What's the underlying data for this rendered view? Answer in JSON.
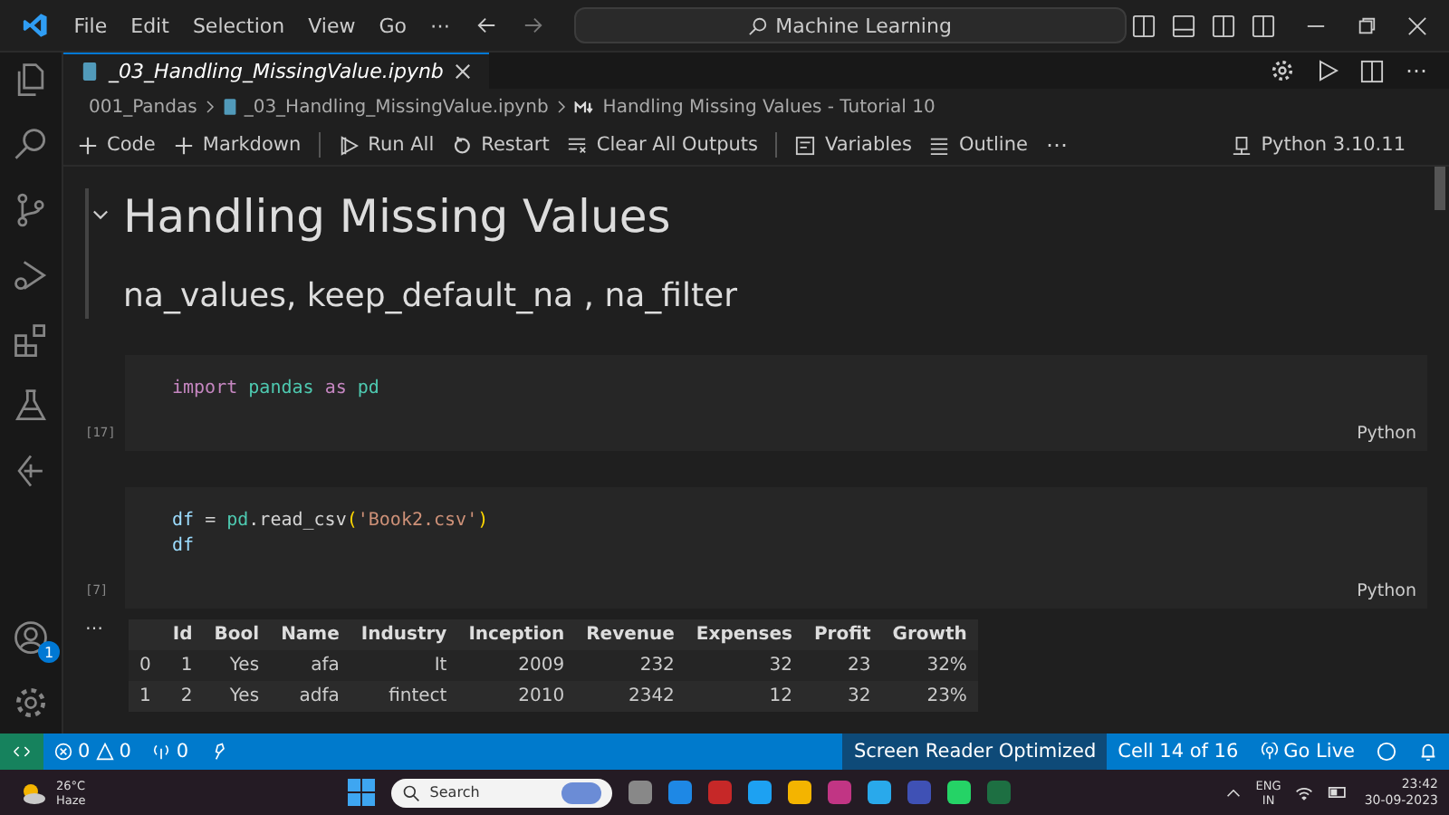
{
  "title_bar": {
    "menus": [
      "File",
      "Edit",
      "Selection",
      "View",
      "Go"
    ],
    "more": "⋯",
    "search": "Machine Learning"
  },
  "activity_bar": {
    "account_badge": "1"
  },
  "editor_tab": {
    "title": "_03_Handling_MissingValue.ipynb",
    "selected": true
  },
  "breadcrumb": [
    "001_Pandas",
    "_03_Handling_MissingValue.ipynb",
    "Handling Missing Values - Tutorial 10"
  ],
  "toolbar": {
    "items": [
      {
        "kind": "add",
        "label": "Code"
      },
      {
        "kind": "add",
        "label": "Markdown"
      },
      {
        "kind": "run",
        "label": "Run All"
      },
      {
        "kind": "restart",
        "label": "Restart"
      },
      {
        "kind": "clear",
        "label": "Clear All Outputs"
      },
      {
        "kind": "variables",
        "label": "Variables"
      },
      {
        "kind": "outline",
        "label": "Outline"
      }
    ],
    "more": "⋯",
    "kernel": "Python 3.10.11"
  },
  "cells": [
    {
      "kind": "markdown",
      "expanded": true,
      "heading": "Handling Missing Values",
      "subheading": "na_values, keep_default_na , na_filter"
    },
    {
      "kind": "code",
      "execution": "[17]",
      "language": "Python",
      "lines": [
        [
          {
            "kind": "keyword",
            "text": "import "
          },
          {
            "kind": "module",
            "text": "pandas "
          },
          {
            "kind": "keyword",
            "text": "as "
          },
          {
            "kind": "module",
            "text": "pd"
          }
        ]
      ]
    },
    {
      "kind": "code",
      "execution": "[7]",
      "language": "Python",
      "lines": [
        [
          {
            "kind": "variable",
            "text": "df"
          },
          {
            "kind": "plain",
            "text": " = "
          },
          {
            "kind": "module",
            "text": "pd"
          },
          {
            "kind": "plain",
            "text": ".read_csv"
          },
          {
            "kind": "bracket",
            "text": "("
          },
          {
            "kind": "string",
            "text": "'Book2.csv'"
          },
          {
            "kind": "bracket",
            "text": ")"
          }
        ],
        [
          {
            "kind": "variable",
            "text": "df"
          }
        ]
      ],
      "output": {
        "more": "⋯",
        "columns": [
          "",
          "Id",
          "Bool",
          "Name",
          "Industry",
          "Inception",
          "Revenue",
          "Expenses",
          "Profit",
          "Growth"
        ],
        "rows": [
          [
            "0",
            "1",
            "Yes",
            "afa",
            "It",
            "2009",
            "232",
            "32",
            "23",
            "32%"
          ],
          [
            "1",
            "2",
            "Yes",
            "adfa",
            "fintect",
            "2010",
            "2342",
            "12",
            "32",
            "23%"
          ]
        ]
      }
    }
  ],
  "status_bar": {
    "errors": "0",
    "warnings": "0",
    "ports": "0",
    "right": [
      {
        "kind": "highlight",
        "label": "Screen Reader Optimized"
      },
      {
        "kind": "plain",
        "label": "Cell 14 of 16"
      },
      {
        "kind": "live",
        "label": "Go Live"
      }
    ]
  },
  "taskbar": {
    "temperature": "26°C",
    "weather": "Haze",
    "search": "Search",
    "language": [
      "ENG",
      "IN"
    ],
    "time": "23:42",
    "date": "30-09-2023"
  }
}
